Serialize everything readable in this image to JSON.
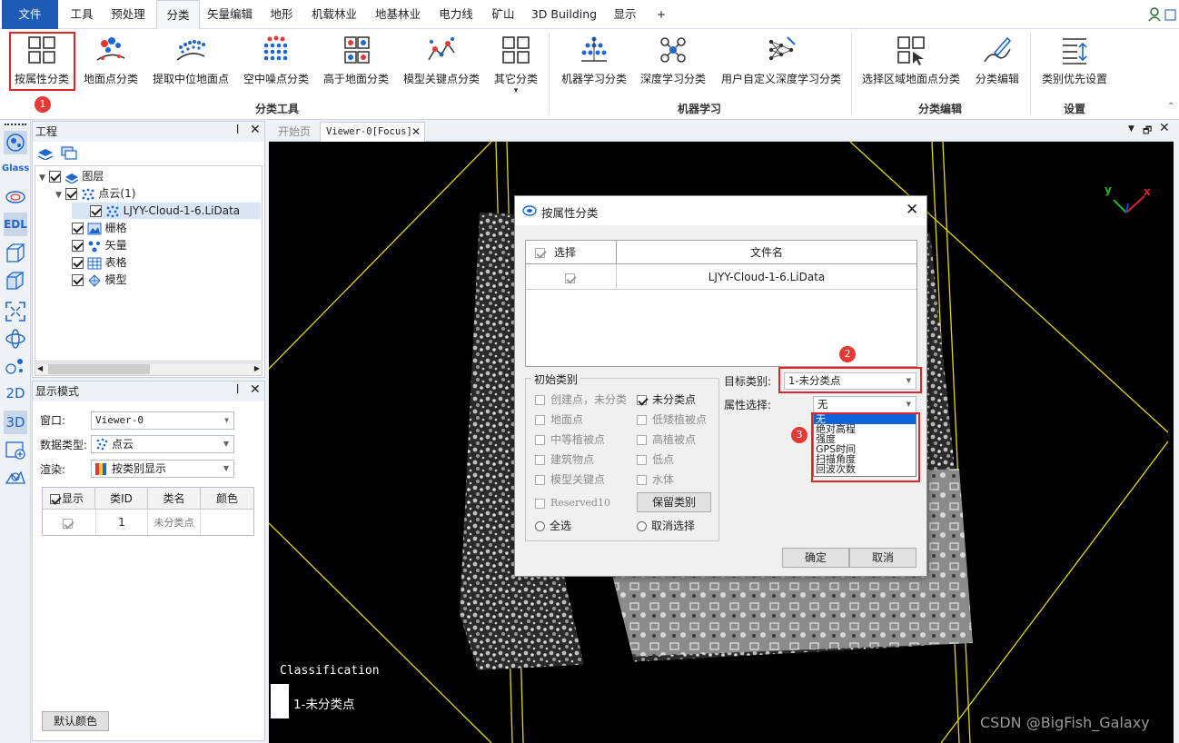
{
  "menu": {
    "items": [
      "文件",
      "工具",
      "预处理",
      "分类",
      "矢量编辑",
      "地形",
      "机载林业",
      "地基林业",
      "电力线",
      "矿山",
      "3D Building",
      "显示",
      "+"
    ],
    "active": "分类"
  },
  "ribbon": {
    "buttons": [
      "按属性分类",
      "地面点分类",
      "提取中位地面点",
      "空中噪点分类",
      "高于地面分类",
      "模型关键点分类",
      "其它分类",
      "机器学习分类",
      "深度学习分类",
      "用户自定义深度学习分类",
      "选择区域地面点分类",
      "分类编辑",
      "类别优先设置"
    ],
    "groups": [
      "分类工具",
      "机器学习",
      "分类编辑",
      "设置"
    ],
    "dropdown_arrow": "▾"
  },
  "left_toolbar": {
    "glass_label": "Glass",
    "edl_label": "EDL",
    "label_2d": "2D",
    "label_3d": "3D"
  },
  "project_panel": {
    "title": "工程",
    "pin_icon": "pin-icon",
    "tree": [
      {
        "label": "图层",
        "checked": true,
        "icon": "layers-icon"
      },
      {
        "label": "点云(1)",
        "checked": true,
        "icon": "pointcloud-icon"
      },
      {
        "label": "LJYY-Cloud-1-6.LiData",
        "checked": true,
        "icon": "pointcloud-icon"
      },
      {
        "label": "栅格",
        "checked": true,
        "icon": "raster-icon"
      },
      {
        "label": "矢量",
        "checked": true,
        "icon": "vector-icon"
      },
      {
        "label": "表格",
        "checked": true,
        "icon": "table-icon"
      },
      {
        "label": "模型",
        "checked": true,
        "icon": "model-icon"
      }
    ]
  },
  "display_panel": {
    "title": "显示模式",
    "window_label": "窗口:",
    "window_value": "Viewer-0",
    "datatype_label": "数据类型:",
    "datatype_value": "点云",
    "render_label": "渲染:",
    "render_value": "按类别显示",
    "table_headers": [
      "显示",
      "类ID",
      "类名",
      "颜色"
    ],
    "table_rows": [
      {
        "show": true,
        "id": "1",
        "name": "未分类点"
      }
    ],
    "default_color_button": "默认颜色"
  },
  "tabs": {
    "start": "开始页",
    "viewer": "Viewer-0[Focus]"
  },
  "viewer": {
    "legend_title": "Classification",
    "legend_item": "1-未分类点",
    "axis_y": "y",
    "axis_x": "x",
    "watermark": "CSDN @BigFish_Galaxy"
  },
  "dialog": {
    "title": "按属性分类",
    "file_table_headers": [
      "选择",
      "文件名"
    ],
    "file_rows": [
      {
        "checked": true,
        "name": "LJYY-Cloud-1-6.LiData"
      }
    ],
    "initial_class_legend": "初始类别",
    "classes": [
      {
        "label": "创建点，未分类",
        "checked": false,
        "enabled": false
      },
      {
        "label": "未分类点",
        "checked": true,
        "enabled": true
      },
      {
        "label": "地面点",
        "checked": false,
        "enabled": false
      },
      {
        "label": "低矮植被点",
        "checked": false,
        "enabled": false
      },
      {
        "label": "中等植被点",
        "checked": false,
        "enabled": false
      },
      {
        "label": "高植被点",
        "checked": false,
        "enabled": false
      },
      {
        "label": "建筑物点",
        "checked": false,
        "enabled": false
      },
      {
        "label": "低点",
        "checked": false,
        "enabled": false
      },
      {
        "label": "模型关键点",
        "checked": false,
        "enabled": false
      },
      {
        "label": "水体",
        "checked": false,
        "enabled": false
      },
      {
        "label": "Reserved10",
        "checked": false,
        "enabled": false
      }
    ],
    "keep_class_button": "保留类别",
    "select_all": "全选",
    "deselect": "取消选择",
    "target_label": "目标类别:",
    "target_value": "1-未分类点",
    "attr_label": "属性选择:",
    "attr_value": "无",
    "attr_options": [
      "无",
      "绝对高程",
      "强度",
      "GPS时间",
      "扫描角度",
      "回波次数"
    ],
    "ok_button": "确定",
    "cancel_button": "取消"
  },
  "badges": [
    "1",
    "2",
    "3"
  ]
}
